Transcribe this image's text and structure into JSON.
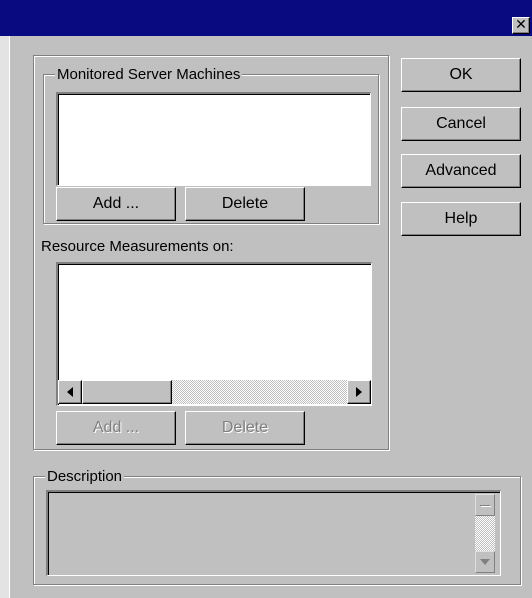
{
  "window": {
    "close_glyph": "✕"
  },
  "monitored_servers": {
    "legend": "Monitored Server Machines",
    "items": [],
    "add_label": "Add ...",
    "delete_label": "Delete"
  },
  "resource_measurements": {
    "label": "Resource Measurements on:",
    "items": [],
    "add_label": "Add ...",
    "delete_label": "Delete",
    "buttons_enabled": false
  },
  "side_buttons": {
    "ok_label": "OK",
    "cancel_label": "Cancel",
    "advanced_label": "Advanced",
    "help_label": "Help"
  },
  "description": {
    "legend": "Description",
    "text": ""
  },
  "colors": {
    "titlebar": "#0a0a80",
    "face": "#c0c0c0",
    "field": "#ffffff",
    "disabled_text": "#808080"
  }
}
